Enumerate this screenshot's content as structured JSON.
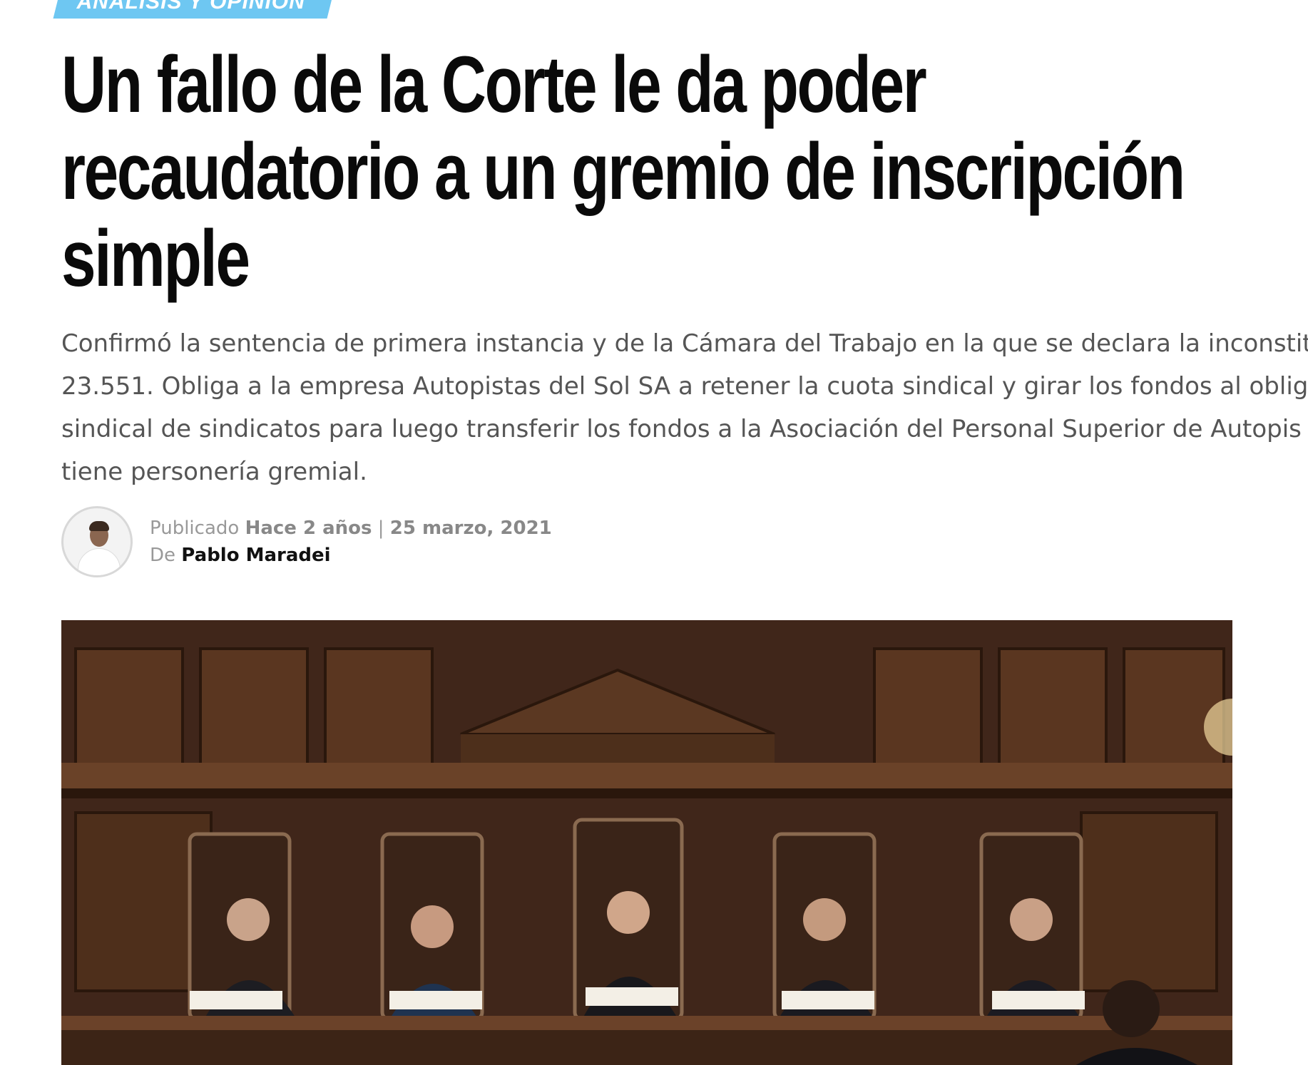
{
  "category": {
    "label": "ANÁLISIS Y OPINIÓN",
    "color": "#6ec7f2"
  },
  "article": {
    "headline_lines": [
      "Un fallo de la Corte le da poder",
      "recaudatorio a un gremio de inscripción",
      "simple"
    ],
    "summary_lines": [
      "Confirmó la sentencia de primera instancia y de la Cámara del Trabajo en la que se declara la inconstitu",
      "23.551. Obliga a la empresa Autopistas del Sol SA a retener la cuota sindical y girar los fondos al obliga",
      "sindical de sindicatos para luego transferir los fondos a la Asociación del Personal Superior de Autopis",
      "tiene personería gremial."
    ]
  },
  "meta": {
    "published_prefix": "Publicado",
    "relative_time": "Hace 2 años",
    "separator": "|",
    "date": "25 marzo, 2021",
    "by_prefix": "De",
    "author": "Pablo Maradei"
  },
  "hero_image": {
    "description_icon": "courtroom-photo",
    "wood_color": "#4a2c18"
  }
}
